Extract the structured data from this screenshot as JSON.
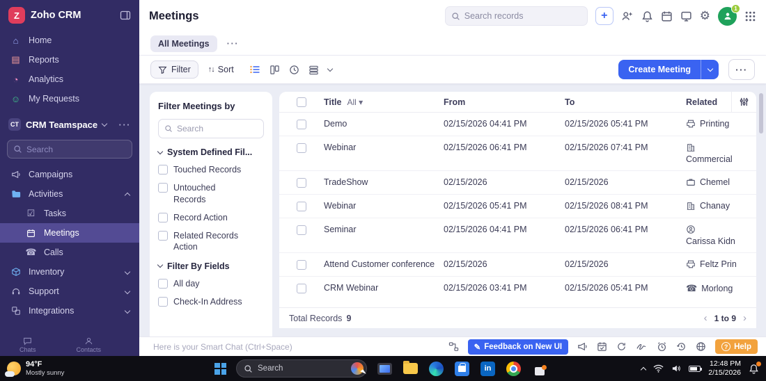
{
  "app": {
    "brand": "Zoho CRM"
  },
  "colors": {
    "sidebar_bg": "#322c64",
    "active_item": "#534b94",
    "accent_blue": "#3a63f1",
    "help_orange": "#f2a23d",
    "avatar_green": "#1fa25b",
    "logo_red": "#e03d5c"
  },
  "sidebar": {
    "top_items": [
      {
        "label": "Home"
      },
      {
        "label": "Reports"
      },
      {
        "label": "Analytics"
      },
      {
        "label": "My Requests"
      }
    ],
    "teamspace": {
      "label": "CRM Teamspace"
    },
    "search_placeholder": "Search",
    "menu": {
      "campaigns": "Campaigns",
      "activities": "Activities",
      "tasks": "Tasks",
      "meetings": "Meetings",
      "calls": "Calls",
      "inventory": "Inventory",
      "support": "Support",
      "integrations": "Integrations"
    },
    "shortcuts": [
      {
        "label": "Chats"
      },
      {
        "label": "Contacts"
      }
    ]
  },
  "header": {
    "title": "Meetings",
    "search_placeholder": "Search records",
    "avatar_badge": "1"
  },
  "view_tabs": {
    "active_tab": "All Meetings"
  },
  "toolbar": {
    "filter": "Filter",
    "sort": "Sort",
    "create": "Create Meeting"
  },
  "filter_panel": {
    "title": "Filter Meetings by",
    "search_placeholder": "Search",
    "section1": {
      "label": "System Defined Fil...",
      "items": [
        "Touched Records",
        "Untouched Records",
        "Record Action",
        "Related Records Action"
      ]
    },
    "section2": {
      "label": "Filter By Fields",
      "items": [
        "All day",
        "Check-In Address"
      ]
    }
  },
  "table": {
    "columns": {
      "title": "Title",
      "title_filter": "All",
      "from": "From",
      "to": "To",
      "related": "Related"
    },
    "rows": [
      {
        "title": "Demo",
        "from": "02/15/2026 04:41 PM",
        "to": "02/15/2026 05:41 PM",
        "related": "Printing",
        "related_icon": "printer"
      },
      {
        "title": "Webinar",
        "from": "02/15/2026 06:41 PM",
        "to": "02/15/2026 07:41 PM",
        "related": "Commercial",
        "related_icon": "building"
      },
      {
        "title": "TradeShow",
        "from": "02/15/2026",
        "to": "02/15/2026",
        "related": "Chemel",
        "related_icon": "briefcase"
      },
      {
        "title": "Webinar",
        "from": "02/15/2026 05:41 PM",
        "to": "02/15/2026 08:41 PM",
        "related": "Chanay",
        "related_icon": "building"
      },
      {
        "title": "Seminar",
        "from": "02/15/2026 04:41 PM",
        "to": "02/15/2026 06:41 PM",
        "related": "Carissa Kidn",
        "related_icon": "contact"
      },
      {
        "title": "Attend Customer conference",
        "from": "02/15/2026",
        "to": "02/15/2026",
        "related": "Feltz Prin",
        "related_icon": "printer"
      },
      {
        "title": "CRM Webinar",
        "from": "02/15/2026 03:41 PM",
        "to": "02/15/2026 05:41 PM",
        "related": "Morlong",
        "related_icon": "phone"
      }
    ],
    "footer": {
      "total_label": "Total Records",
      "total_value": "9",
      "range": "1 to 9"
    }
  },
  "bottom_bar": {
    "smart_chat_placeholder": "Here is your Smart Chat (Ctrl+Space)",
    "feedback": "Feedback on New UI",
    "help": "Help"
  },
  "taskbar": {
    "weather_temp": "94°F",
    "weather_condition": "Mostly sunny",
    "search_placeholder": "Search",
    "time": "12:48 PM",
    "date": "2/15/2026"
  }
}
